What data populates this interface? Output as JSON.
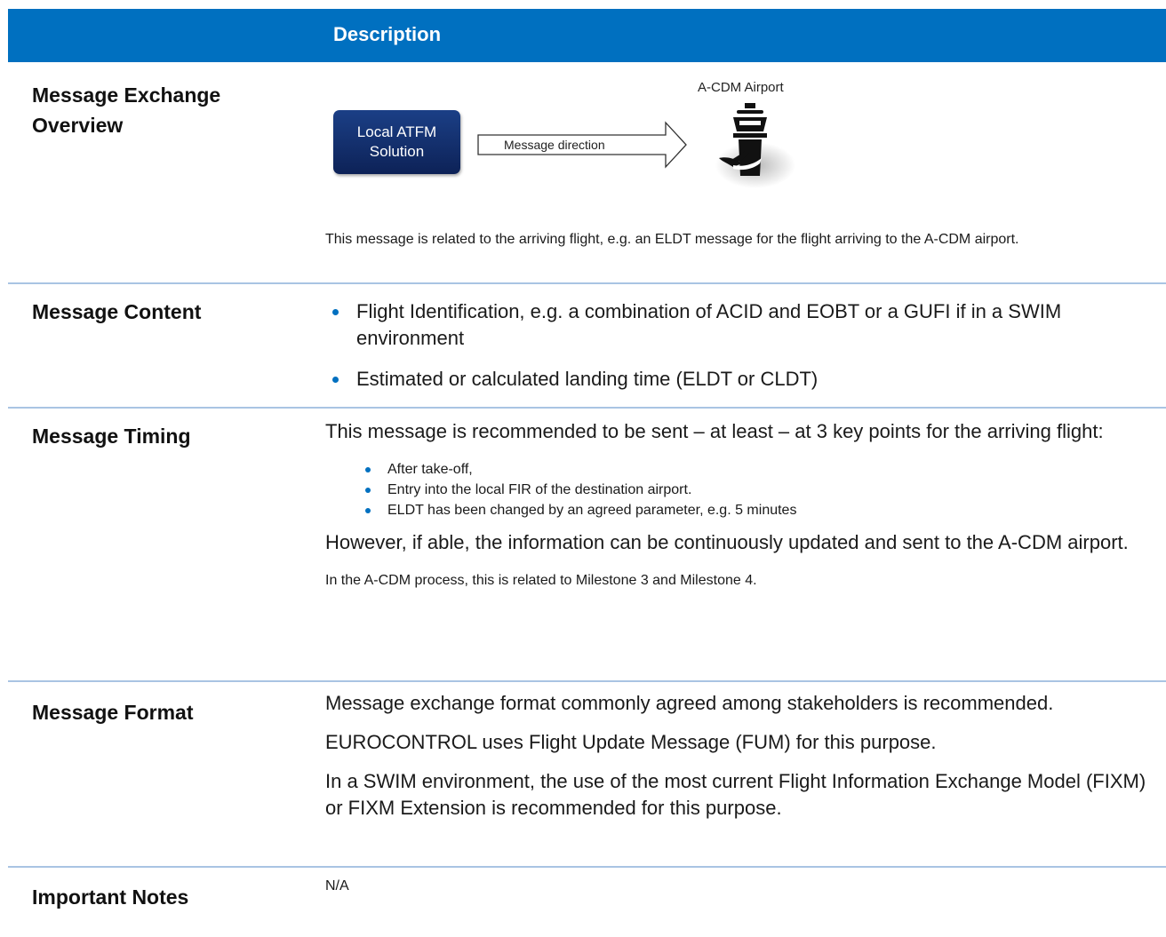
{
  "header": {
    "title": "Description"
  },
  "overview": {
    "label_line1": "Message Exchange",
    "label_line2": "Overview",
    "diagram": {
      "source_line1": "Local ATFM",
      "source_line2": "Solution",
      "arrow_label": "Message direction",
      "target_label": "A-CDM Airport"
    },
    "note": "This message is related to the arriving flight, e.g. an ELDT message for the flight arriving to the A-CDM airport."
  },
  "content": {
    "label": "Message Content",
    "bullets": [
      "Flight Identification, e.g. a combination of ACID and EOBT or a GUFI if in a SWIM environment",
      "Estimated or calculated landing time (ELDT or CLDT)"
    ]
  },
  "timing": {
    "label": "Message Timing",
    "intro": "This message is recommended to be sent – at least – at 3 key points for the arriving flight:",
    "bullets": [
      "After take-off,",
      "Entry into the local FIR of the destination airport.",
      "ELDT has been changed by an agreed parameter, e.g. 5 minutes"
    ],
    "para": "However, if able, the information can be continuously updated and sent to the A-CDM airport.",
    "note": "In the A-CDM process, this is related to Milestone 3 and Milestone 4."
  },
  "format": {
    "label": "Message Format",
    "para1": "Message exchange format commonly agreed among stakeholders is recommended.",
    "para2": "EUROCONTROL uses Flight Update Message (FUM) for this purpose.",
    "para3": "In a SWIM environment, the use of the most current Flight Information Exchange Model (FIXM) or FIXM Extension is recommended for this purpose."
  },
  "notes": {
    "label": "Important Notes",
    "value": "N/A"
  },
  "colors": {
    "accent": "#0070c0",
    "divider": "#a9c4e3"
  }
}
